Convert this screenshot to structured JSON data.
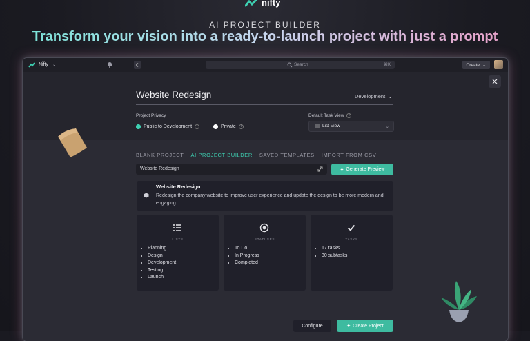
{
  "brand": {
    "name": "nifty"
  },
  "hero": {
    "eyebrow": "AI PROJECT BUILDER",
    "headline": "Transform your vision into a ready-to-launch project with just a prompt"
  },
  "topbar": {
    "workspace": "Nifty",
    "search_placeholder": "Search",
    "search_shortcut": "⌘K",
    "create_label": "Create"
  },
  "modal": {
    "project_name": "Website Redesign",
    "team": "Development",
    "privacy_label": "Project Privacy",
    "privacy_options": [
      {
        "label": "Public to Development",
        "selected": true
      },
      {
        "label": "Private",
        "selected": false
      }
    ],
    "task_view_label": "Default Task View",
    "task_view_value": "List View",
    "tabs": [
      {
        "label": "BLANK PROJECT",
        "active": false
      },
      {
        "label": "AI PROJECT BUILDER",
        "active": true
      },
      {
        "label": "SAVED TEMPLATES",
        "active": false
      },
      {
        "label": "IMPORT FROM CSV",
        "active": false
      }
    ],
    "prompt_value": "Website Redesign",
    "generate_label": "Generate Preview",
    "preview": {
      "title": "Website Redesign",
      "description": "Redesign the company website to improve user experience and update the design to be more modern and engaging."
    },
    "columns": [
      {
        "heading": "LISTS",
        "icon": "list-icon",
        "items": [
          "Planning",
          "Design",
          "Development",
          "Testing",
          "Launch"
        ]
      },
      {
        "heading": "STATUSES",
        "icon": "status-icon",
        "items": [
          "To Do",
          "In Progress",
          "Completed"
        ]
      },
      {
        "heading": "TASKS",
        "icon": "check-icon",
        "items": [
          "17 tasks",
          "30 subtasks"
        ]
      }
    ],
    "configure_label": "Configure",
    "create_project_label": "Create Project"
  },
  "colors": {
    "accent": "#3ebba0",
    "teal": "#3ecfb1",
    "pink": "#e6a1c9"
  }
}
